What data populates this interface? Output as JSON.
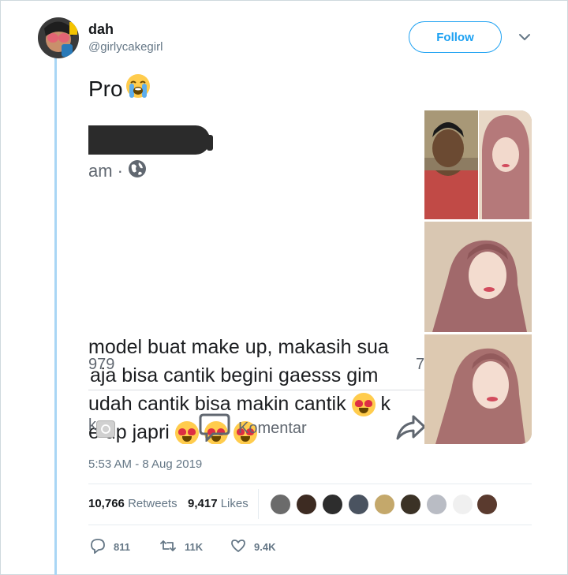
{
  "tweet": {
    "display_name": "dah",
    "handle": "@girlycakegirl",
    "follow_label": "Follow",
    "text": "Pro",
    "timestamp": "5:53 AM - 8 Aug 2019",
    "retweets_count": "10,766",
    "retweets_label": "Retweets",
    "likes_count": "9,417",
    "likes_label": "Likes"
  },
  "embedded_post": {
    "meta_text": "am ·",
    "lines": [
      "model buat make up, makasih sua",
      "aja bisa cantik begini gaesss gim",
      "udah cantik bisa makin cantik",
      "e up japri"
    ],
    "line3_tail": "k",
    "count_left": "979",
    "count_right": "7",
    "action_left": "k",
    "action_comment": "Komentar"
  },
  "actions": {
    "replies": "811",
    "retweets": "11K",
    "likes": "9.4K"
  },
  "colors": {
    "accent": "#1da1f2",
    "thread_line": "#a9d6f5",
    "muted": "#657786"
  }
}
